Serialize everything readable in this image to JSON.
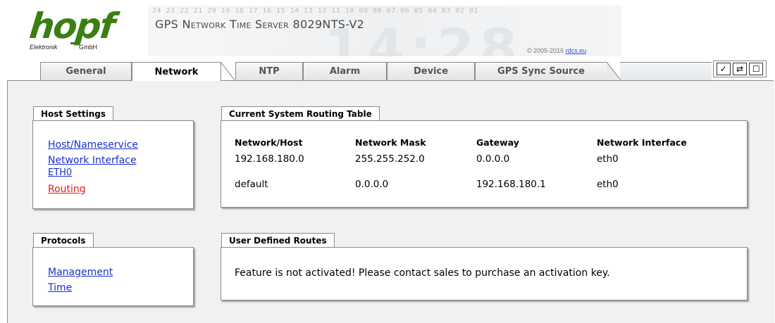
{
  "logo": {
    "word": "hopf",
    "company_left": "Elektronik",
    "company_right": "GmbH",
    "brand_color": "#3b7f12"
  },
  "banner": {
    "digits": "24 23 22 21 20 19 18 17 16 15 14 13 12 11 10 09 08 07 06 05 04 03 02 01",
    "clock": "14:28",
    "title": "GPS Network Time Server 8029NTS-V2",
    "copyright_prefix": "© 2005-2016",
    "copyright_link": "rdcs.eu"
  },
  "tabs": [
    {
      "label": "General",
      "active": false
    },
    {
      "label": "Network",
      "active": true
    },
    {
      "label": "NTP",
      "active": false
    },
    {
      "label": "Alarm",
      "active": false
    },
    {
      "label": "Device",
      "active": false
    },
    {
      "label": "GPS Sync Source",
      "active": false
    }
  ],
  "toolbar_icons": [
    {
      "name": "apply-check-icon",
      "glyph": "✓"
    },
    {
      "name": "reload-arrows-icon",
      "glyph": "⇄"
    },
    {
      "name": "save-square-icon",
      "glyph": "☐"
    }
  ],
  "host_settings": {
    "legend": "Host Settings",
    "links": [
      {
        "label": "Host/Nameservice",
        "active": false
      },
      {
        "label": "Network Interface",
        "active": false
      },
      {
        "label": "ETH0",
        "active": false
      },
      {
        "label": "Routing",
        "active": true
      }
    ]
  },
  "protocols": {
    "legend": "Protocols",
    "links": [
      {
        "label": "Management",
        "active": false
      },
      {
        "label": "Time",
        "active": false
      }
    ]
  },
  "routing_table": {
    "legend": "Current System Routing Table",
    "headers": [
      "Network/Host",
      "Network Mask",
      "Gateway",
      "Network Interface"
    ],
    "rows": [
      [
        "192.168.180.0",
        "255.255.252.0",
        "0.0.0.0",
        "eth0"
      ],
      [
        "default",
        "0.0.0.0",
        "192.168.180.1",
        "eth0"
      ]
    ]
  },
  "user_routes": {
    "legend": "User Defined Routes",
    "message": "Feature is not activated! Please contact sales to purchase an activation key."
  },
  "colors": {
    "link": "#1a2fd1",
    "active_link": "#e02020",
    "content_bg": "#f1f1f1",
    "border": "#8a8a8a"
  }
}
